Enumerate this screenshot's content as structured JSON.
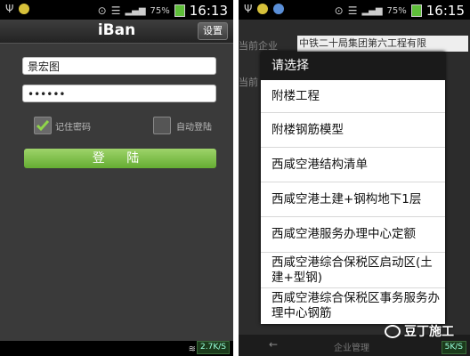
{
  "left_screen": {
    "status": {
      "battery_pct": "75%",
      "time": "16:13",
      "usb_icon": "usb-icon"
    },
    "app_title": "iBan",
    "settings_label": "设置",
    "username": "景宏图",
    "password_mask": "••••••",
    "remember_label": "记住密码",
    "auto_login_label": "自动登陆",
    "login_label": "登 陆",
    "speed": "2.7K/S"
  },
  "right_screen": {
    "status": {
      "battery_pct": "75%",
      "time": "16:15"
    },
    "bg_label_1": "当前企业",
    "bg_company": "中铁二十局集团第六工程有限",
    "bg_label_2": "当前",
    "dialog_title": "请选择",
    "options": [
      "附楼工程",
      "附楼钢筋模型",
      "西咸空港结构清单",
      "西咸空港土建+钢构地下1层",
      "西咸空港服务办理中心定额",
      "西咸空港综合保税区启动区(土建+型钢)",
      "西咸空港综合保税区事务服务办理中心钢筋"
    ],
    "nav_back": "←",
    "nav_mgmt": "企业管理",
    "speed": "5K/S"
  },
  "watermark": "豆丁施工",
  "colors": {
    "accent_green": "#6fb83a",
    "status_bar": "#000000"
  }
}
